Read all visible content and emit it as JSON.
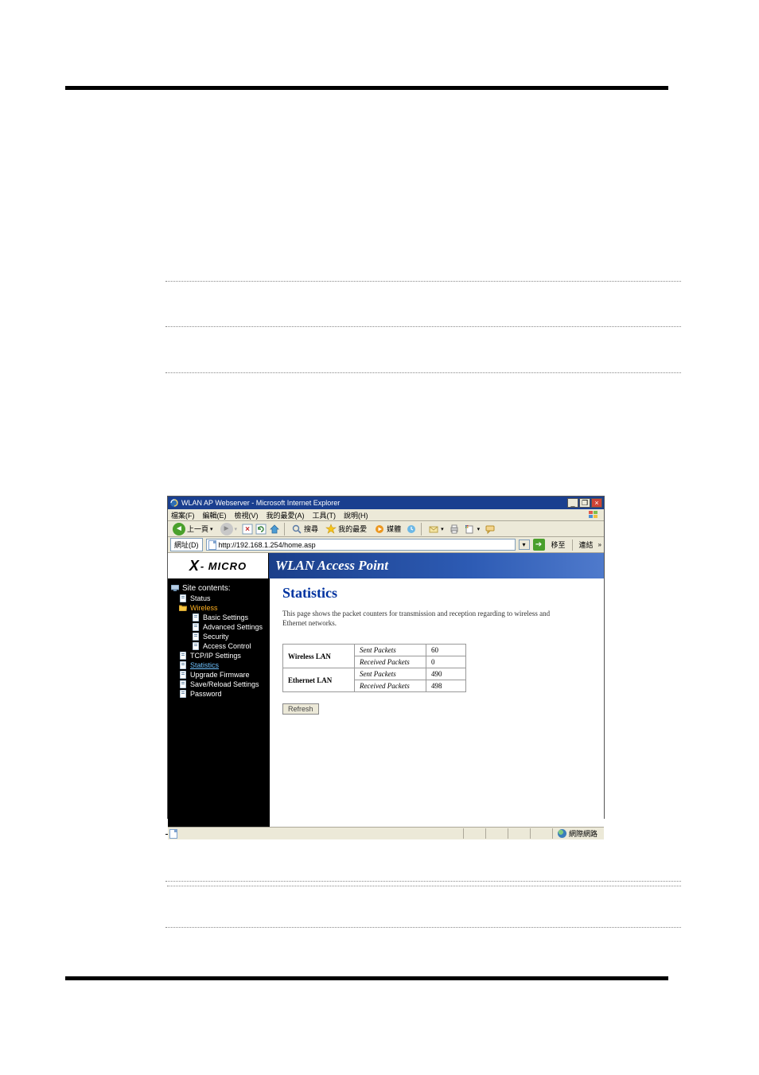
{
  "browser": {
    "title": "WLAN AP Webserver - Microsoft Internet Explorer",
    "menus": [
      "檔案(F)",
      "編輯(E)",
      "檢視(V)",
      "我的最愛(A)",
      "工具(T)",
      "說明(H)"
    ],
    "toolbar": {
      "back": "上一頁",
      "search": "搜尋",
      "favorites": "我的最愛",
      "media": "媒體"
    },
    "addressbar": {
      "label": "網址(D)",
      "url": "http://192.168.1.254/home.asp",
      "go_label": "移至",
      "links_label": "連結"
    },
    "statusbar": {
      "zone": "網際網路"
    }
  },
  "logo": {
    "x": "X",
    "text": "- MICRO"
  },
  "banner": {
    "title": "WLAN Access Point"
  },
  "sidebar": {
    "root": "Site contents:",
    "items": [
      {
        "label": "Status"
      },
      {
        "label": "Wireless"
      },
      {
        "label": "Basic Settings"
      },
      {
        "label": "Advanced Settings"
      },
      {
        "label": "Security"
      },
      {
        "label": "Access Control"
      },
      {
        "label": "TCP/IP Settings"
      },
      {
        "label": "Statistics"
      },
      {
        "label": "Upgrade Firmware"
      },
      {
        "label": "Save/Reload Settings"
      },
      {
        "label": "Password"
      }
    ]
  },
  "page": {
    "heading": "Statistics",
    "description": "This page shows the packet counters for transmission and reception regarding to wireless and Ethernet networks.",
    "refresh": "Refresh"
  },
  "chart_data": {
    "type": "table",
    "rows": [
      {
        "interface": "Wireless LAN",
        "stat": "Sent Packets",
        "value": "60"
      },
      {
        "interface": "Wireless LAN",
        "stat": "Received Packets",
        "value": "0"
      },
      {
        "interface": "Ethernet LAN",
        "stat": "Sent Packets",
        "value": "490"
      },
      {
        "interface": "Ethernet LAN",
        "stat": "Received Packets",
        "value": "498"
      }
    ]
  }
}
